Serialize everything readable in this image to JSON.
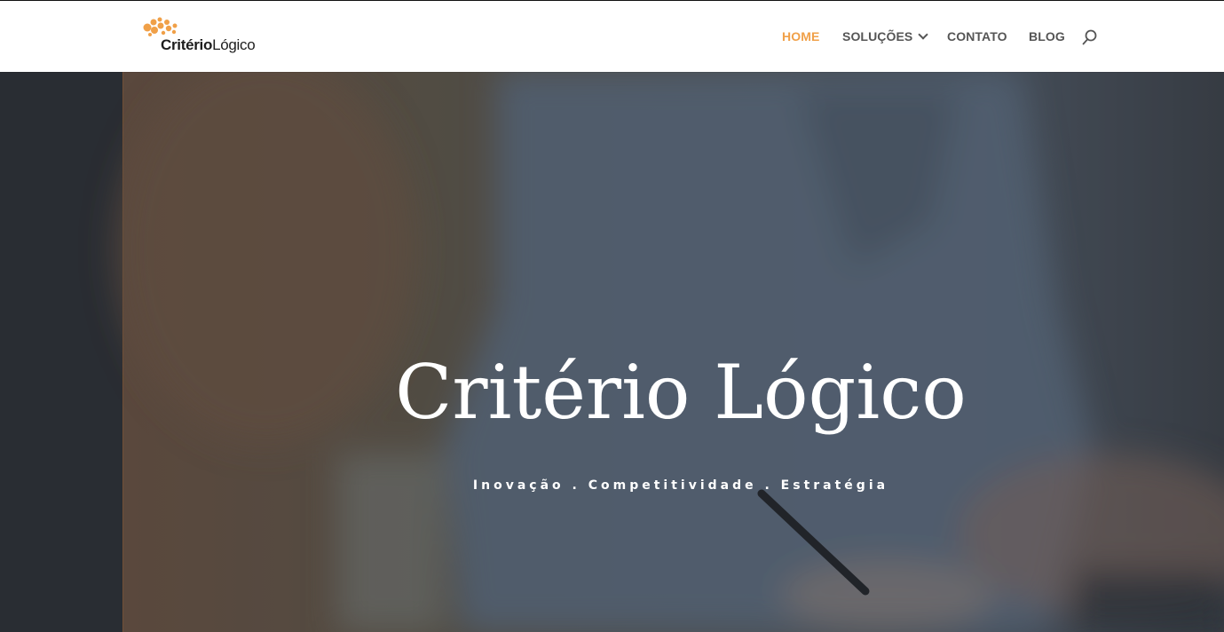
{
  "brand": {
    "name_bold": "Critério",
    "name_light": "Lógico",
    "accent_color": "#f0a048"
  },
  "nav": {
    "items": [
      {
        "label": "HOME",
        "active": true
      },
      {
        "label": "SOLUÇÕES",
        "has_dropdown": true
      },
      {
        "label": "CONTATO"
      },
      {
        "label": "BLOG"
      }
    ],
    "search_icon": "search-icon"
  },
  "hero": {
    "title": "Critério Lógico",
    "subtitle": "Inovação . Competitividade . Estratégia"
  }
}
